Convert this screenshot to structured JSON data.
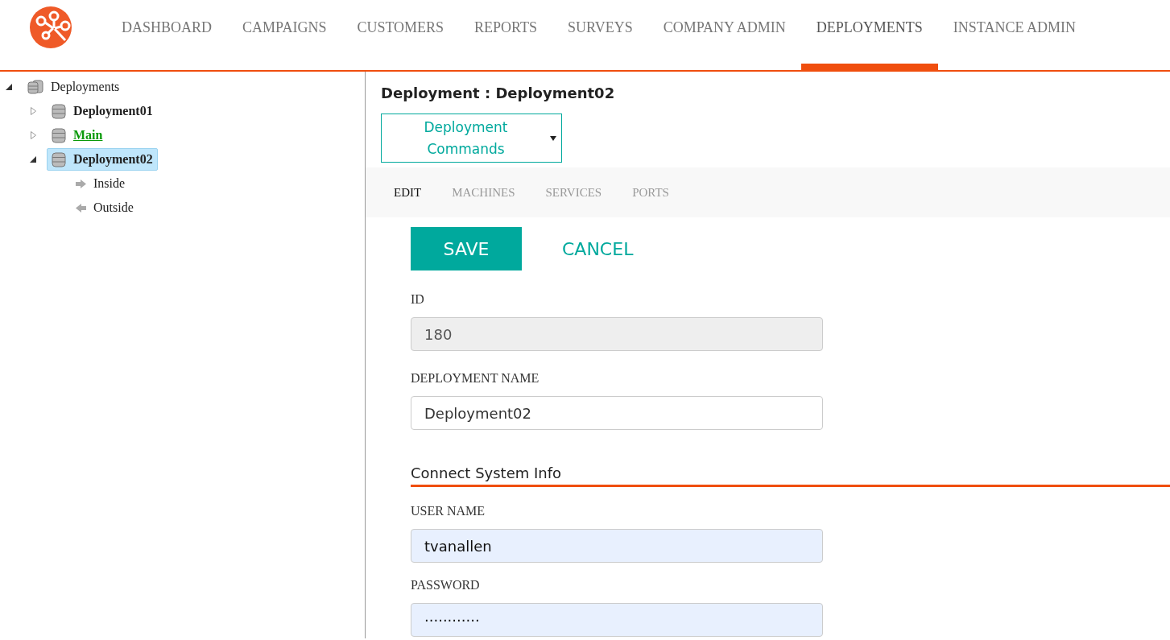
{
  "nav": {
    "items": [
      {
        "label": "DASHBOARD",
        "selected": false
      },
      {
        "label": "CAMPAIGNS",
        "selected": false
      },
      {
        "label": "CUSTOMERS",
        "selected": false
      },
      {
        "label": "REPORTS",
        "selected": false
      },
      {
        "label": "SURVEYS",
        "selected": false
      },
      {
        "label": "COMPANY ADMIN",
        "selected": false
      },
      {
        "label": "DEPLOYMENTS",
        "selected": true
      },
      {
        "label": "INSTANCE ADMIN",
        "selected": false
      }
    ]
  },
  "tree": [
    {
      "label": "Deployments",
      "kind": "databases",
      "expanded": true,
      "selected": false,
      "link": false,
      "children": [
        {
          "label": "Deployment01",
          "kind": "database",
          "expanded": false,
          "selected": false,
          "link": false
        },
        {
          "label": "Main",
          "kind": "database",
          "expanded": false,
          "selected": false,
          "link": true
        },
        {
          "label": "Deployment02",
          "kind": "database",
          "expanded": true,
          "selected": true,
          "link": false,
          "children": [
            {
              "label": "Inside",
              "kind": "arrow-right",
              "selected": false,
              "link": false
            },
            {
              "label": "Outside",
              "kind": "arrow-left",
              "selected": false,
              "link": false
            }
          ]
        }
      ]
    }
  ],
  "detail": {
    "title": "Deployment : Deployment02",
    "commands": "Deployment Commands",
    "tabs": [
      {
        "label": "EDIT",
        "selected": true
      },
      {
        "label": "MACHINES",
        "selected": false
      },
      {
        "label": "SERVICES",
        "selected": false
      },
      {
        "label": "PORTS",
        "selected": false
      }
    ],
    "save": "SAVE",
    "cancel": "CANCEL",
    "fields": [
      {
        "label": "ID",
        "value": "180",
        "disabled": true
      },
      {
        "label": "DEPLOYMENT NAME",
        "value": "Deployment02",
        "disabled": false,
        "autofilled": false
      }
    ],
    "section": "Connect System Info",
    "section_fields": [
      {
        "label": "USER NAME",
        "value": "tvanallen",
        "disabled": false,
        "autofilled": true
      },
      {
        "label": "PASSWORD",
        "value": "············",
        "disabled": false,
        "autofilled": true
      }
    ]
  }
}
